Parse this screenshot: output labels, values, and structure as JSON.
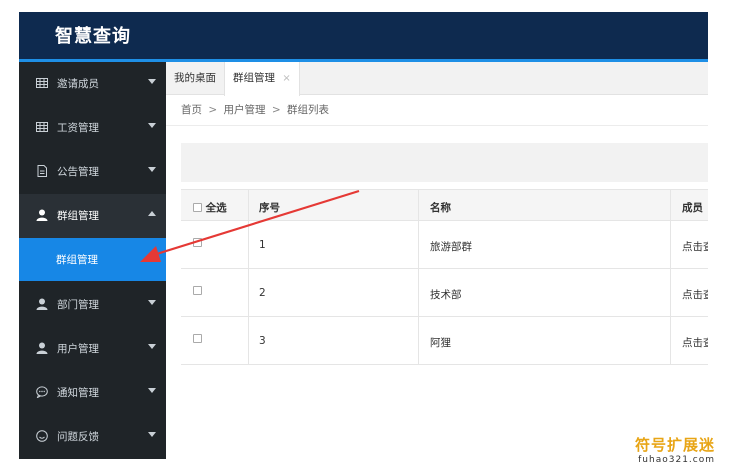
{
  "app": {
    "title": "智慧查询"
  },
  "sidebar": {
    "items": [
      {
        "label": "邀请成员",
        "icon": "table-icon",
        "expanded": false
      },
      {
        "label": "工资管理",
        "icon": "table-icon",
        "expanded": false
      },
      {
        "label": "公告管理",
        "icon": "document-icon",
        "expanded": false
      },
      {
        "label": "群组管理",
        "icon": "user-icon",
        "expanded": true,
        "children": [
          {
            "label": "群组管理",
            "active": true
          }
        ]
      },
      {
        "label": "部门管理",
        "icon": "user-icon",
        "expanded": false
      },
      {
        "label": "用户管理",
        "icon": "user-icon",
        "expanded": false
      },
      {
        "label": "通知管理",
        "icon": "chat-icon",
        "expanded": false
      },
      {
        "label": "问题反馈",
        "icon": "smile-icon",
        "expanded": false
      }
    ]
  },
  "tabs": [
    {
      "label": "我的桌面",
      "active": false
    },
    {
      "label": "群组管理",
      "active": true,
      "close": "×"
    }
  ],
  "breadcrumb": {
    "items": [
      "首页",
      "用户管理",
      "群组列表"
    ],
    "separator": ">"
  },
  "table": {
    "select_all_label": "全选",
    "columns": [
      "序号",
      "名称",
      "成员"
    ],
    "rows": [
      {
        "no": "1",
        "name": "旅游部群",
        "members": "点击查"
      },
      {
        "no": "2",
        "name": "技术部",
        "members": "点击查"
      },
      {
        "no": "3",
        "name": "阿狸",
        "members": "点击查"
      }
    ]
  },
  "watermark": {
    "line1": "符号扩展迷",
    "line2": "fuhao321.com"
  },
  "colors": {
    "topbar": "#0e2a4f",
    "accent": "#1e8fe6",
    "sidebar": "#1f2428",
    "active_item": "#1787e6",
    "annotation_arrow": "#e53935"
  }
}
